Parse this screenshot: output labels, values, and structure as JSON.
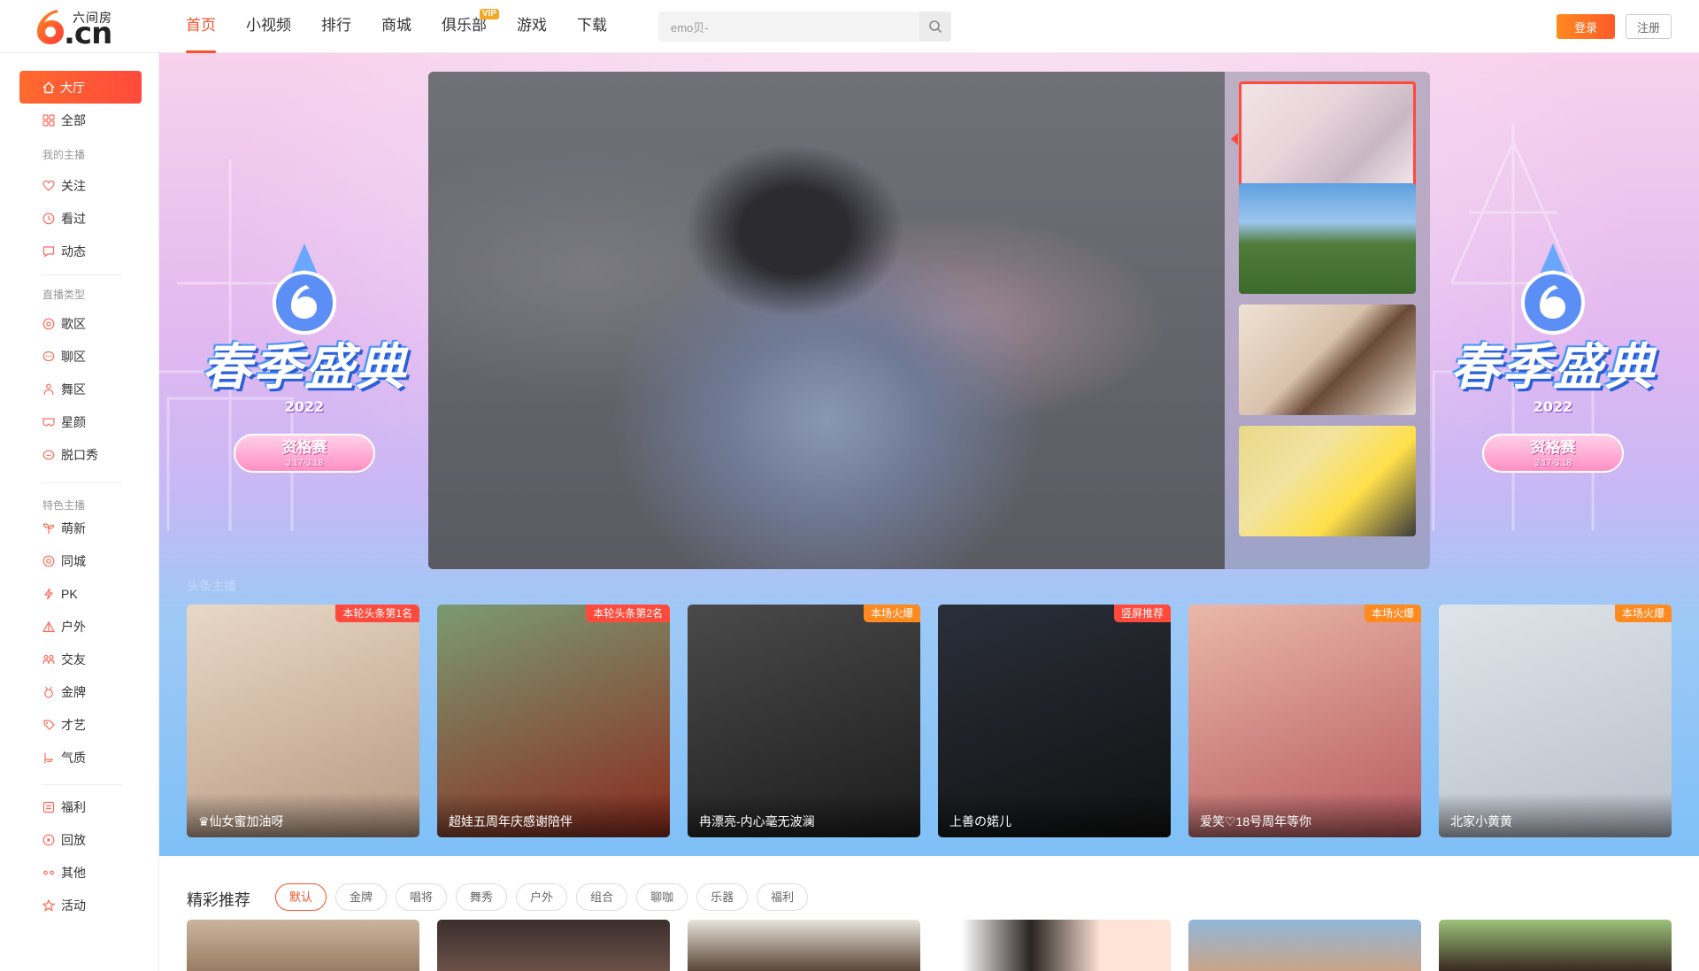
{
  "header": {
    "logo_top": "六间房",
    "logo_cn": ".cn",
    "logo_six": "6",
    "nav": [
      {
        "label": "首页",
        "active": true
      },
      {
        "label": "小视频"
      },
      {
        "label": "排行"
      },
      {
        "label": "商城"
      },
      {
        "label": "俱乐部",
        "badge": "VIP"
      },
      {
        "label": "游戏"
      },
      {
        "label": "下载"
      }
    ],
    "search_value": "emo贝-",
    "search_icon": "search-icon",
    "login_label": "登录",
    "register_label": "注册",
    "accent_color": "#f7502c"
  },
  "sidebar": {
    "active": {
      "label": "大厅",
      "icon": "home-icon"
    },
    "all": {
      "label": "全部",
      "icon": "grid-icon"
    },
    "group_my": "我的主播",
    "my_items": [
      {
        "label": "关注",
        "icon": "heart-icon"
      },
      {
        "label": "看过",
        "icon": "clock-icon"
      },
      {
        "label": "动态",
        "icon": "chat-icon"
      }
    ],
    "group_type": "直播类型",
    "type_items": [
      {
        "label": "歌区",
        "icon": "music-icon"
      },
      {
        "label": "聊区",
        "icon": "bubble-icon"
      },
      {
        "label": "舞区",
        "icon": "dancer-icon"
      },
      {
        "label": "星颜",
        "icon": "mask-icon"
      },
      {
        "label": "脱口秀",
        "icon": "mic-icon"
      }
    ],
    "group_feature": "特色主播",
    "feature_items": [
      {
        "label": "萌新",
        "icon": "sprout-icon"
      },
      {
        "label": "同城",
        "icon": "location-icon"
      },
      {
        "label": "PK",
        "icon": "lightning-icon"
      },
      {
        "label": "户外",
        "icon": "tent-icon"
      },
      {
        "label": "交友",
        "icon": "people-icon"
      },
      {
        "label": "金牌",
        "icon": "medal-icon"
      },
      {
        "label": "才艺",
        "icon": "palette-icon"
      },
      {
        "label": "气质",
        "icon": "flag-icon"
      }
    ],
    "other_items": [
      {
        "label": "福利",
        "icon": "gift-icon"
      },
      {
        "label": "回放",
        "icon": "play-icon"
      },
      {
        "label": "其他",
        "icon": "dots-icon"
      },
      {
        "label": "活动",
        "icon": "star-icon"
      }
    ]
  },
  "banner": {
    "event_title": "春季盛典",
    "event_year": "2022",
    "event_stage": "资格赛",
    "event_dates": "3.17-3.18",
    "section_label": "头条主播"
  },
  "live_cards": [
    {
      "name": "♛仙女蜜加油呀",
      "badge": "本轮头条第1名",
      "badge_color": "#ff4a3c",
      "tone": [
        "#e8d8c6",
        "#b89a84"
      ]
    },
    {
      "name": "超娃五周年庆感谢陪伴",
      "badge": "本轮头条第2名",
      "badge_color": "#ff4a3c",
      "tone": [
        "#7a9b72",
        "#8a2a1e"
      ]
    },
    {
      "name": "冉漂亮-内心毫无波澜",
      "badge": "本场火爆",
      "badge_color": "#ff8a1f",
      "tone": [
        "#4a4a4a",
        "#1c1c1c"
      ]
    },
    {
      "name": "上善の婼儿",
      "badge": "竖屏推荐",
      "badge_color": "#ff4a3c",
      "tone": [
        "#2a2f3a",
        "#111"
      ]
    },
    {
      "name": "爱笑♡18号周年等你",
      "badge": "本场火爆",
      "badge_color": "#ff8a1f",
      "tone": [
        "#e9b8a8",
        "#b85a60"
      ]
    },
    {
      "name": "北家小黄黄",
      "badge": "本场火爆",
      "badge_color": "#ff8a1f",
      "tone": [
        "#dfe4ea",
        "#b8c0c9"
      ]
    }
  ],
  "recommend": {
    "title": "精彩推荐",
    "filters": [
      "默认",
      "金牌",
      "唱将",
      "舞秀",
      "户外",
      "组合",
      "聊咖",
      "乐器",
      "福利"
    ],
    "active_filter": "默认"
  }
}
